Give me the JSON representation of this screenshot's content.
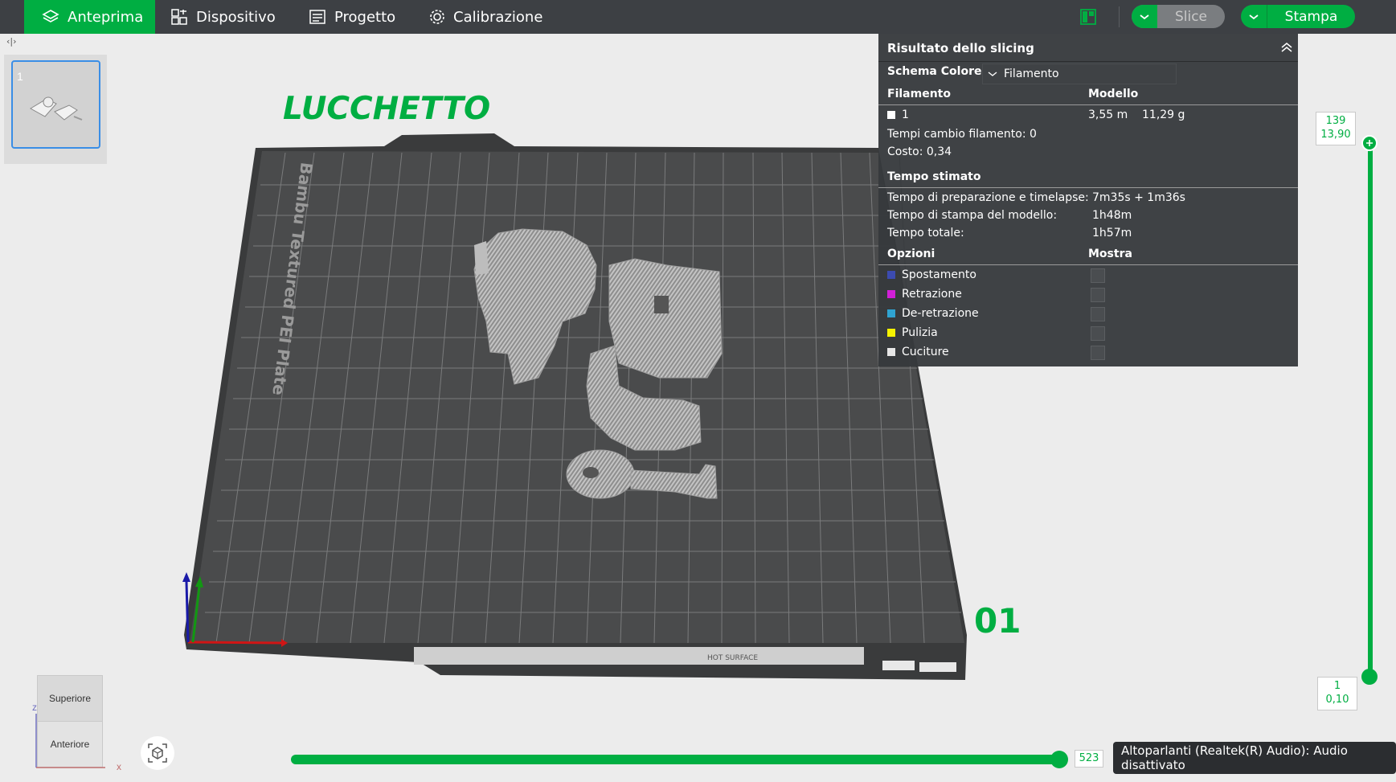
{
  "tabs": [
    {
      "label": "Anteprima",
      "icon": "layers-icon"
    },
    {
      "label": "Dispositivo",
      "icon": "device-icon"
    },
    {
      "label": "Progetto",
      "icon": "project-icon"
    },
    {
      "label": "Calibrazione",
      "icon": "calibration-icon"
    }
  ],
  "toolbar": {
    "slice_label": "Slice",
    "print_label": "Stampa",
    "layout_icon": "layout-icon"
  },
  "plate": {
    "number": "1",
    "project_title": "LUCCHETTO",
    "plate_label": "Bambu Textured PEI Plate",
    "plate_number": "01",
    "hot_surface": "HOT SURFACE"
  },
  "slicing": {
    "title": "Risultato dello slicing",
    "color_scheme_label": "Schema Colore",
    "color_scheme_value": "Filamento",
    "col_filament": "Filamento",
    "col_model": "Modello",
    "filament_id": "1",
    "filament_length": "3,55 m",
    "filament_weight": "11,29 g",
    "change_times": "Tempi cambio filamento:  0",
    "cost": "Costo:  0,34",
    "estimated_title": "Tempo stimato",
    "prep_label": "Tempo di preparazione e timelapse:",
    "prep_value": "7m35s + 1m36s",
    "print_label": "Tempo di stampa del modello:",
    "print_value": "1h48m",
    "total_label": "Tempo totale:",
    "total_value": "1h57m",
    "options_title": "Opzioni",
    "show_title": "Mostra",
    "options": [
      {
        "label": "Spostamento",
        "color": "#3c4bb0"
      },
      {
        "label": "Retrazione",
        "color": "#d21fd8"
      },
      {
        "label": "De-retrazione",
        "color": "#2fa3d1"
      },
      {
        "label": "Pulizia",
        "color": "#f5f200"
      },
      {
        "label": "Cuciture",
        "color": "#e6e6e6"
      }
    ]
  },
  "layer_slider": {
    "top_layer": "139",
    "top_height": "13,90",
    "bottom_layer": "1",
    "bottom_height": "0,10"
  },
  "move_slider": {
    "value": "523"
  },
  "view_cube": {
    "top": "Superiore",
    "front": "Anteriore",
    "x_axis": "x",
    "z_axis": "z"
  },
  "tooltip": {
    "text": "Altoparlanti (Realtek(R) Audio): Audio disattivato"
  },
  "colors": {
    "accent": "#00ae42",
    "bar": "#3d4044"
  }
}
